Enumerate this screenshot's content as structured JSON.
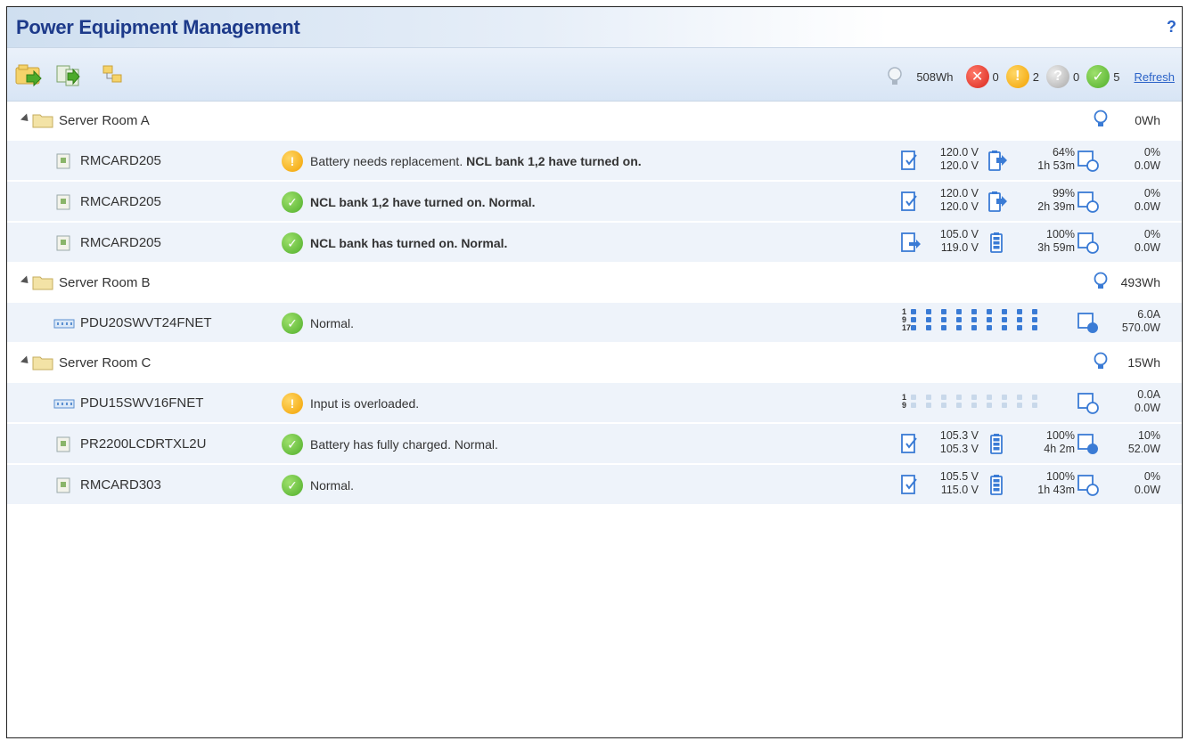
{
  "title": "Power Equipment Management",
  "help_label": "?",
  "toolbar": {
    "total_energy": "508Wh",
    "counts": {
      "error": "0",
      "warning": "2",
      "unknown": "0",
      "normal": "5"
    },
    "refresh_label": "Refresh"
  },
  "groups": [
    {
      "name": "Server Room A",
      "energy": "0Wh",
      "devices": [
        {
          "name": "RMCARD205",
          "status": "warning",
          "message_plain": "Battery needs replacement. ",
          "message_bold": "NCL bank 1,2 have turned on.",
          "v1": "120.0 V",
          "v2": "120.0 V",
          "pct": "64%",
          "time": "1h 53m",
          "load": "0%",
          "power": "0.0W"
        },
        {
          "name": "RMCARD205",
          "status": "normal",
          "message_plain": "",
          "message_bold": "NCL bank 1,2 have turned on. Normal.",
          "v1": "120.0 V",
          "v2": "120.0 V",
          "pct": "99%",
          "time": "2h 39m",
          "load": "0%",
          "power": "0.0W"
        },
        {
          "name": "RMCARD205",
          "status": "normal",
          "message_plain": "",
          "message_bold": "NCL bank has turned on. Normal.",
          "v1": "105.0 V",
          "v2": "119.0 V",
          "pct": "100%",
          "time": "3h 59m",
          "load": "0%",
          "power": "0.0W"
        }
      ]
    },
    {
      "name": "Server Room B",
      "energy": "493Wh",
      "devices": [
        {
          "name": "PDU20SWVT24FNET",
          "status": "normal",
          "message_plain": "Normal.",
          "current": "6.0A",
          "power": "570.0W",
          "outlet_labels": [
            "1",
            "9",
            "17"
          ]
        }
      ]
    },
    {
      "name": "Server Room C",
      "energy": "15Wh",
      "devices": [
        {
          "name": "PDU15SWV16FNET",
          "status": "warning",
          "message_plain": "Input is overloaded.",
          "current": "0.0A",
          "power": "0.0W",
          "outlet_labels": [
            "1",
            "9"
          ]
        },
        {
          "name": "PR2200LCDRTXL2U",
          "status": "normal",
          "message_plain": "Battery has fully charged. Normal.",
          "v1": "105.3 V",
          "v2": "105.3 V",
          "pct": "100%",
          "time": "4h 2m",
          "load": "10%",
          "power": "52.0W"
        },
        {
          "name": "RMCARD303",
          "status": "normal",
          "message_plain": "Normal.",
          "v1": "105.5 V",
          "v2": "115.0 V",
          "pct": "100%",
          "time": "1h 43m",
          "load": "0%",
          "power": "0.0W"
        }
      ]
    }
  ],
  "colors": {
    "title": "#1d3a8a",
    "link": "#2b63c8",
    "row_bg": "#eef3fa",
    "warning": "#f2a100",
    "normal": "#4fae2a",
    "error": "#d9261c"
  }
}
